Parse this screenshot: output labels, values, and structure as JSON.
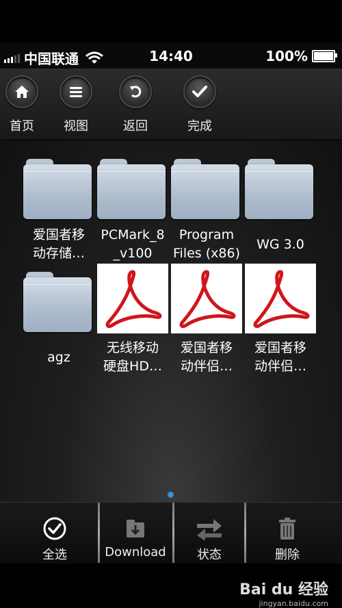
{
  "status_bar": {
    "carrier": "中国联通",
    "time": "14:40",
    "battery": "100%",
    "battery_level": 1.0
  },
  "toolbar": {
    "home": "首页",
    "view": "视图",
    "back": "返回",
    "done": "完成"
  },
  "files": [
    {
      "type": "folder",
      "name": "爱国者移\n动存储…"
    },
    {
      "type": "folder",
      "name": "PCMark_8\n_v100"
    },
    {
      "type": "folder",
      "name": "Program\nFiles (x86)"
    },
    {
      "type": "folder",
      "name": "WG 3.0"
    },
    {
      "type": "folder",
      "name": "agz"
    },
    {
      "type": "pdf",
      "name": "无线移动\n硬盘HD…"
    },
    {
      "type": "pdf",
      "name": "爱国者移\n动伴侣…"
    },
    {
      "type": "pdf",
      "name": "爱国者移\n动伴侣…"
    }
  ],
  "bottom_bar": {
    "select_all": "全选",
    "download": "Download",
    "status": "状态",
    "delete": "删除"
  },
  "watermark": {
    "brand": "Bai du 经验",
    "url": "jingyan.baidu.com"
  },
  "colors": {
    "page_dot": "#3a8fd9",
    "pdf_red": "#d0161b"
  }
}
